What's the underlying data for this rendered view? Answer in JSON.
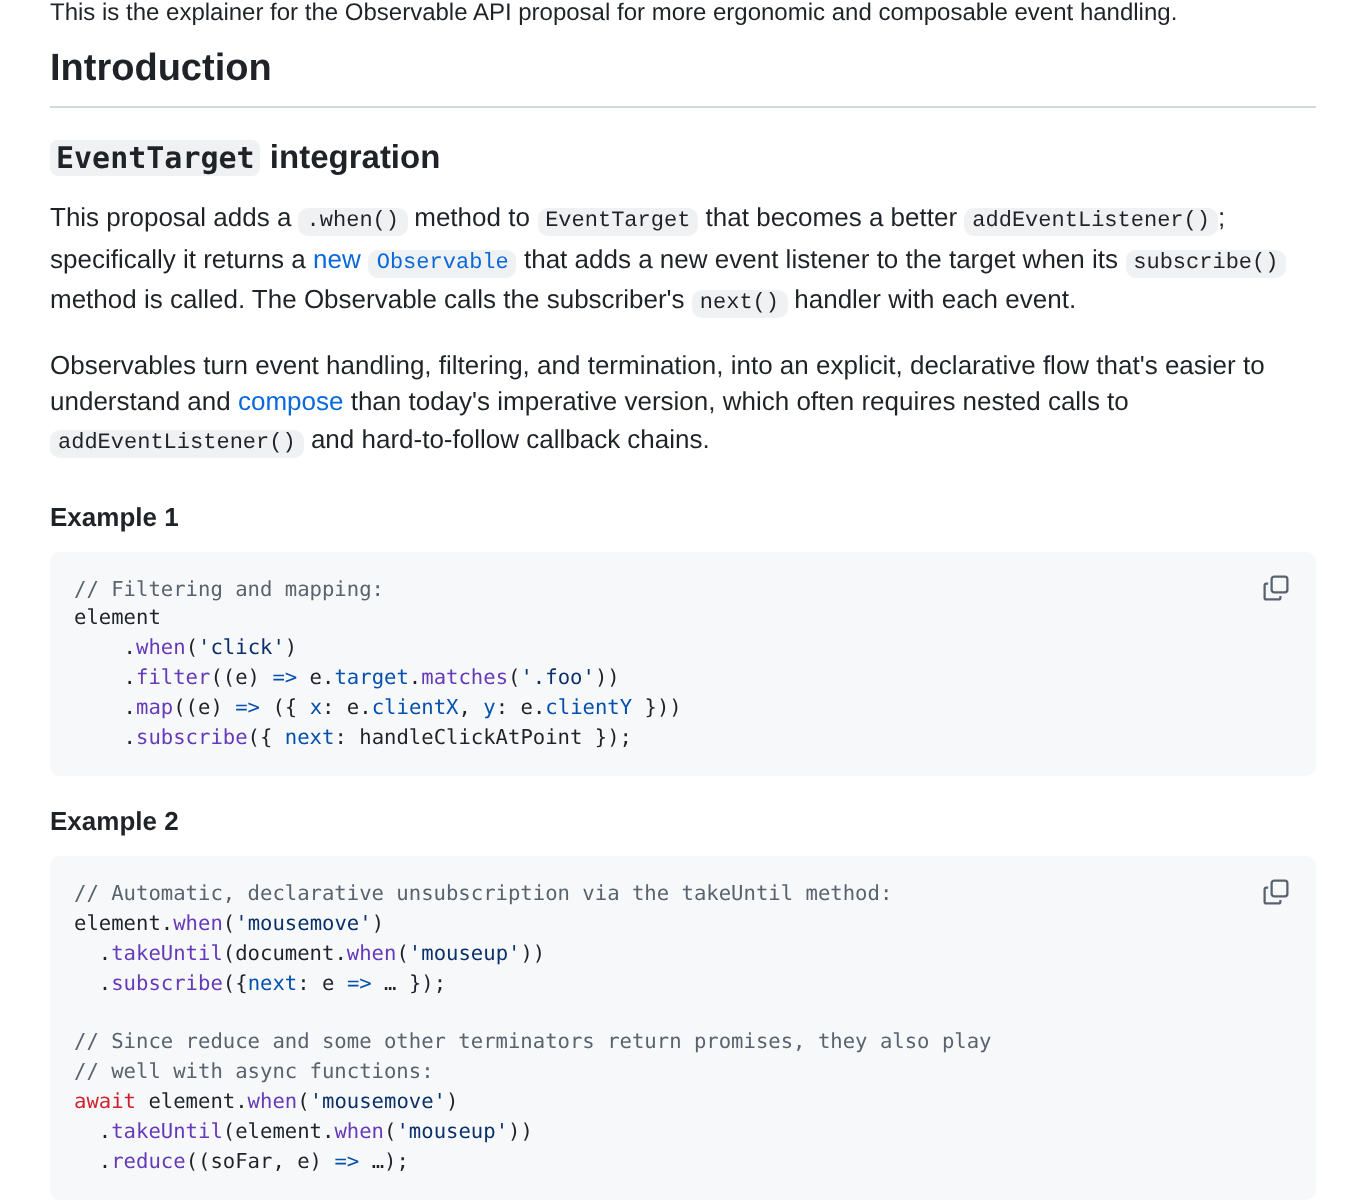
{
  "intro_line": "This is the explainer for the Observable API proposal for more ergonomic and composable event handling.",
  "heading": "Introduction",
  "subheading": {
    "code": "EventTarget",
    "text": " integration"
  },
  "paragraphs": [
    [
      {
        "kind": "text",
        "text": "This proposal adds a "
      },
      {
        "kind": "code",
        "text": ".when()"
      },
      {
        "kind": "text",
        "text": " method to "
      },
      {
        "kind": "code",
        "text": "EventTarget"
      },
      {
        "kind": "text",
        "text": " that becomes a better "
      },
      {
        "kind": "code",
        "text": "addEventListener()"
      },
      {
        "kind": "text",
        "text": "; specifically it returns a "
      },
      {
        "kind": "link",
        "text": "new"
      },
      {
        "kind": "link_code",
        "text": "Observable"
      },
      {
        "kind": "text",
        "text": " that adds a new event listener to the target when its "
      },
      {
        "kind": "code",
        "text": "subscribe()"
      },
      {
        "kind": "text",
        "text": " method is called. The Observable calls the subscriber's "
      },
      {
        "kind": "code",
        "text": "next()"
      },
      {
        "kind": "text",
        "text": " handler with each event."
      }
    ],
    [
      {
        "kind": "text",
        "text": "Observables turn event handling, filtering, and termination, into an explicit, declarative flow that's easier to understand and "
      },
      {
        "kind": "link",
        "text": "compose"
      },
      {
        "kind": "text",
        "text": " than today's imperative version, which often requires nested calls to "
      },
      {
        "kind": "code",
        "text": "addEventListener()"
      },
      {
        "kind": "text",
        "text": " and hard-to-follow callback chains."
      }
    ]
  ],
  "examples": [
    {
      "title": "Example 1",
      "lines": [
        {
          "kind": "code",
          "tokens": [
            {
              "kind": "comment",
              "text": "// Filtering and mapping:"
            }
          ]
        },
        {
          "kind": "code",
          "tokens": [
            {
              "kind": "plain",
              "text": "element"
            }
          ]
        },
        {
          "kind": "code",
          "tokens": [
            {
              "kind": "method",
              "text": "    .when"
            },
            {
              "kind": "plain",
              "text": "("
            },
            {
              "kind": "string",
              "text": "'click'"
            },
            {
              "kind": "plain",
              "text": ")"
            }
          ]
        },
        {
          "kind": "code",
          "tokens": [
            {
              "kind": "method",
              "text": "    .filter"
            },
            {
              "kind": "plain",
              "text": "((e) "
            },
            {
              "kind": "keyword",
              "text": "=>"
            },
            {
              "kind": "plain",
              "text": " e."
            },
            {
              "kind": "prop",
              "text": "target"
            },
            {
              "kind": "plain",
              "text": "."
            },
            {
              "kind": "func",
              "text": "matches"
            },
            {
              "kind": "plain",
              "text": "("
            },
            {
              "kind": "string",
              "text": "'.foo'"
            },
            {
              "kind": "plain",
              "text": "))"
            }
          ]
        },
        {
          "kind": "code",
          "tokens": [
            {
              "kind": "method",
              "text": "    .map"
            },
            {
              "kind": "plain",
              "text": "((e) "
            },
            {
              "kind": "keyword",
              "text": "=>"
            },
            {
              "kind": "plain",
              "text": " ({ "
            },
            {
              "kind": "prop",
              "text": "x"
            },
            {
              "kind": "plain",
              "text": ": e."
            },
            {
              "kind": "prop",
              "text": "clientX"
            },
            {
              "kind": "plain",
              "text": ", "
            },
            {
              "kind": "prop",
              "text": "y"
            },
            {
              "kind": "plain",
              "text": ": e."
            },
            {
              "kind": "prop",
              "text": "clientY"
            },
            {
              "kind": "plain",
              "text": " }))"
            }
          ]
        },
        {
          "kind": "code",
          "tokens": [
            {
              "kind": "method",
              "text": "    .subscribe"
            },
            {
              "kind": "plain",
              "text": "({ "
            },
            {
              "kind": "prop",
              "text": "next"
            },
            {
              "kind": "plain",
              "text": ": handleClickAtPoint });"
            }
          ]
        }
      ]
    },
    {
      "title": "Example 2",
      "lines": [
        {
          "kind": "code",
          "tokens": [
            {
              "kind": "comment",
              "text": "// Automatic, declarative unsubscription via the takeUntil method:"
            }
          ]
        },
        {
          "kind": "code",
          "tokens": [
            {
              "kind": "plain",
              "text": "element."
            },
            {
              "kind": "func",
              "text": "when"
            },
            {
              "kind": "plain",
              "text": "("
            },
            {
              "kind": "string",
              "text": "'mousemove'"
            },
            {
              "kind": "plain",
              "text": ")"
            }
          ]
        },
        {
          "kind": "code",
          "tokens": [
            {
              "kind": "plain",
              "text": "  ."
            },
            {
              "kind": "func",
              "text": "takeUntil"
            },
            {
              "kind": "plain",
              "text": "(document."
            },
            {
              "kind": "func",
              "text": "when"
            },
            {
              "kind": "plain",
              "text": "("
            },
            {
              "kind": "string",
              "text": "'mouseup'"
            },
            {
              "kind": "plain",
              "text": "))"
            }
          ]
        },
        {
          "kind": "code",
          "tokens": [
            {
              "kind": "plain",
              "text": "  ."
            },
            {
              "kind": "func",
              "text": "subscribe"
            },
            {
              "kind": "plain",
              "text": "({"
            },
            {
              "kind": "prop",
              "text": "next"
            },
            {
              "kind": "plain",
              "text": ": e "
            },
            {
              "kind": "keyword",
              "text": "=>"
            },
            {
              "kind": "plain",
              "text": " … });"
            }
          ]
        },
        {
          "kind": "blank"
        },
        {
          "kind": "code",
          "tokens": [
            {
              "kind": "comment",
              "text": "// Since reduce and some other terminators return promises, they also play"
            }
          ]
        },
        {
          "kind": "code",
          "tokens": [
            {
              "kind": "comment",
              "text": "// well with async functions:"
            }
          ]
        },
        {
          "kind": "code",
          "tokens": [
            {
              "kind": "await",
              "text": "await"
            },
            {
              "kind": "plain",
              "text": " element."
            },
            {
              "kind": "func",
              "text": "when"
            },
            {
              "kind": "plain",
              "text": "("
            },
            {
              "kind": "string",
              "text": "'mousemove'"
            },
            {
              "kind": "plain",
              "text": ")"
            }
          ]
        },
        {
          "kind": "code",
          "tokens": [
            {
              "kind": "plain",
              "text": "  ."
            },
            {
              "kind": "func",
              "text": "takeUntil"
            },
            {
              "kind": "plain",
              "text": "(element."
            },
            {
              "kind": "func",
              "text": "when"
            },
            {
              "kind": "plain",
              "text": "("
            },
            {
              "kind": "string",
              "text": "'mouseup'"
            },
            {
              "kind": "plain",
              "text": "))"
            }
          ]
        },
        {
          "kind": "code",
          "tokens": [
            {
              "kind": "plain",
              "text": "  ."
            },
            {
              "kind": "func",
              "text": "reduce"
            },
            {
              "kind": "plain",
              "text": "((soFar, e) "
            },
            {
              "kind": "keyword",
              "text": "=>"
            },
            {
              "kind": "plain",
              "text": " …);"
            }
          ]
        }
      ]
    }
  ]
}
